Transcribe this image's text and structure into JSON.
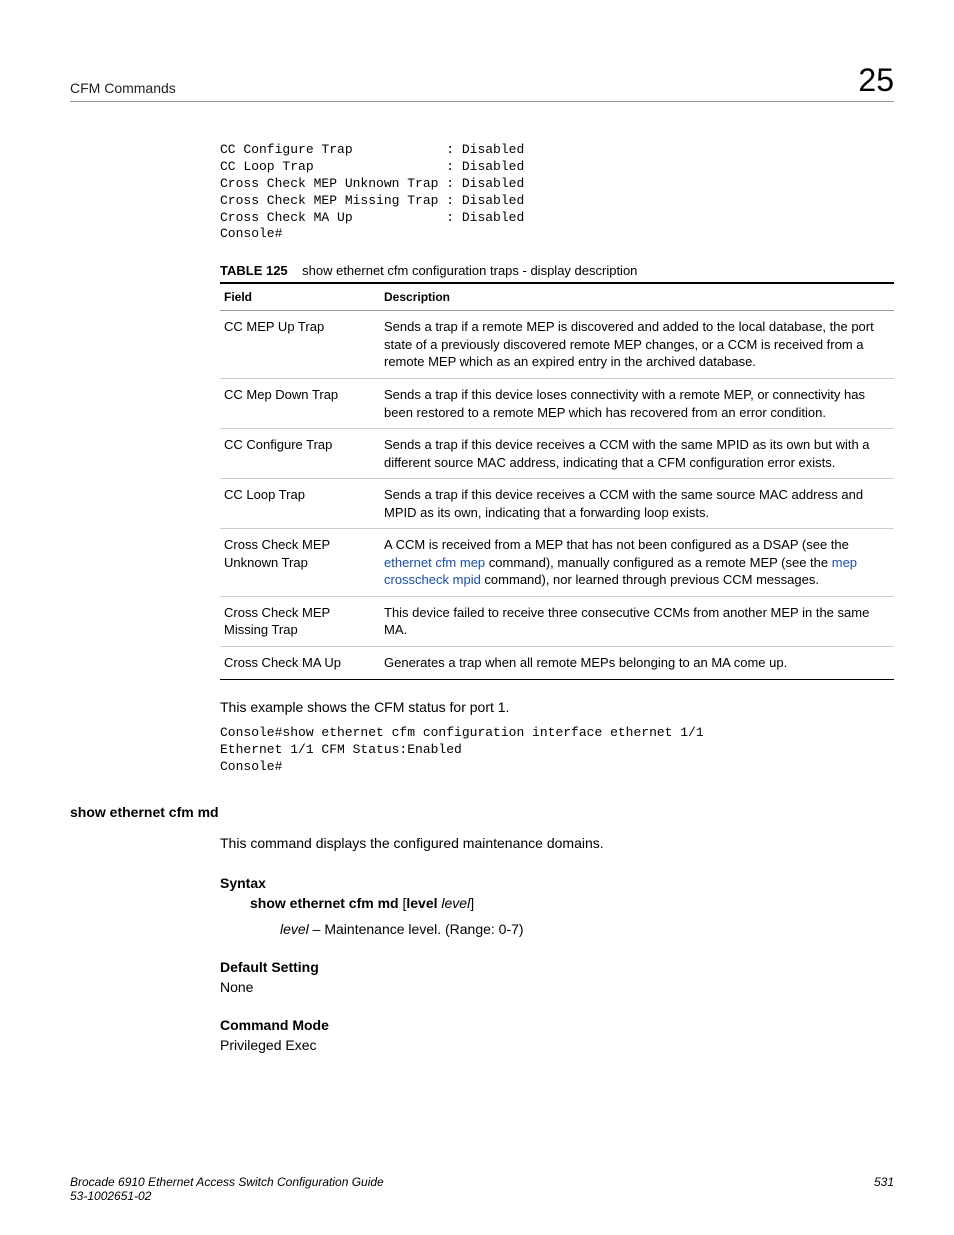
{
  "header": {
    "left": "CFM Commands",
    "right": "25"
  },
  "console_block1": "CC Configure Trap            : Disabled\nCC Loop Trap                 : Disabled\nCross Check MEP Unknown Trap : Disabled\nCross Check MEP Missing Trap : Disabled\nCross Check MA Up            : Disabled\nConsole#",
  "table": {
    "label": "TABLE 125",
    "caption": "show ethernet cfm configuration traps - display description",
    "headers": {
      "col1": "Field",
      "col2": "Description"
    },
    "rows": [
      {
        "field": "CC MEP Up Trap",
        "desc": "Sends a trap if a remote MEP is discovered and added to the local database, the port state of a previously discovered remote MEP changes, or a CCM is received from a remote MEP which as an expired entry in the archived database."
      },
      {
        "field": "CC Mep Down Trap",
        "desc": "Sends a trap if this device loses connectivity with a remote MEP, or connectivity has been restored to a remote MEP which has recovered from an error condition."
      },
      {
        "field": "CC Configure Trap",
        "desc": "Sends a trap if this device receives a CCM with the same MPID as its own but with a different source MAC address, indicating that a CFM configuration error exists."
      },
      {
        "field": "CC Loop Trap",
        "desc": "Sends a trap if this device receives a CCM with the same source MAC address and MPID as its own, indicating that a forwarding loop exists."
      },
      {
        "field": "Cross Check MEP Unknown Trap",
        "desc_pre": "A CCM is received from a MEP that has not been configured as a DSAP (see the ",
        "link1": "ethernet cfm mep",
        "desc_mid1": " command), manually configured as a remote MEP (see the ",
        "link2": "mep crosscheck mpid",
        "desc_post": " command), nor learned through previous CCM messages."
      },
      {
        "field": "Cross Check MEP Missing Trap",
        "desc": "This device failed to receive three consecutive CCMs from another MEP in the same MA."
      },
      {
        "field": "Cross Check MA Up",
        "desc": "Generates a trap when all remote MEPs belonging to an MA come up."
      }
    ]
  },
  "example_text": "This example shows the CFM status for port 1.",
  "console_block2": "Console#show ethernet cfm configuration interface ethernet 1/1\nEthernet 1/1 CFM Status:Enabled\nConsole#",
  "cmd": {
    "name": "show ethernet cfm md",
    "desc": "This command displays the configured maintenance domains.",
    "syntax_heading": "Syntax",
    "syntax_bold": "show ethernet cfm md",
    "syntax_opt_bold": "level",
    "syntax_opt_italic": "level",
    "syntax_open": " [",
    "syntax_close": "]",
    "syntax_space": " ",
    "param_italic": "level",
    "param_rest": " – Maintenance level. (Range: 0-7)",
    "default_heading": "Default Setting",
    "default_value": "None",
    "mode_heading": "Command Mode",
    "mode_value": "Privileged Exec"
  },
  "footer": {
    "doc": "Brocade 6910 Ethernet Access Switch Configuration Guide",
    "partno": "53-1002651-02",
    "page": "531"
  }
}
